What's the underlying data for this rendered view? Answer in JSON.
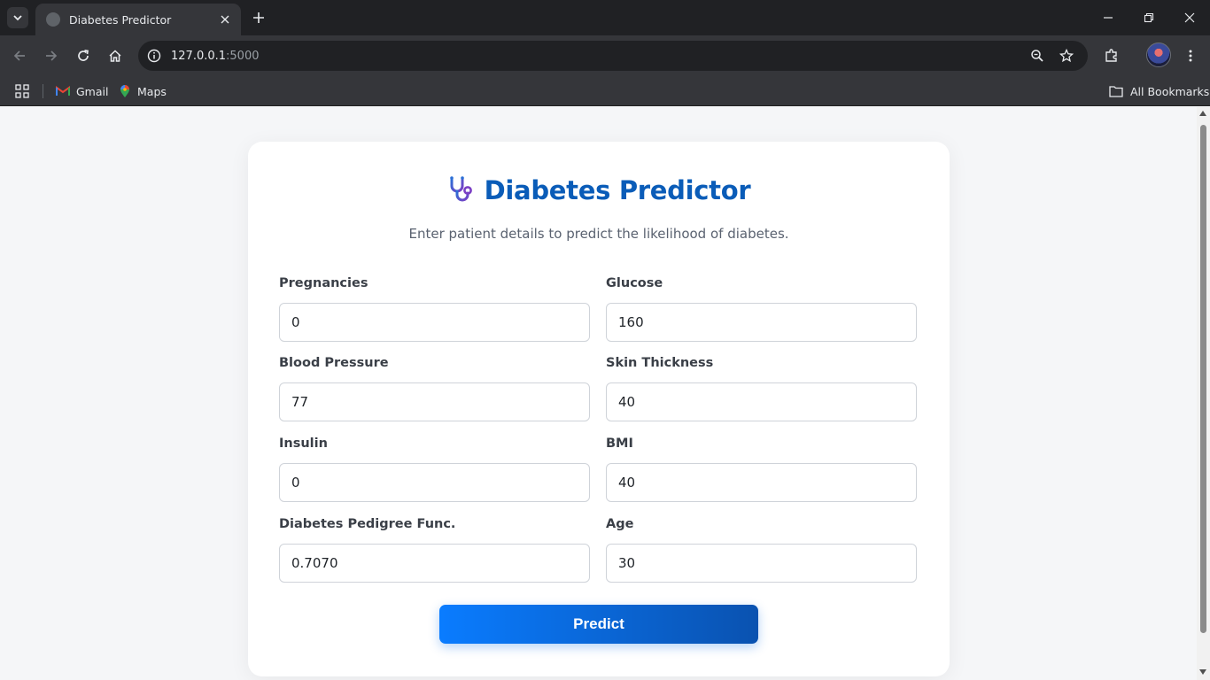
{
  "browser": {
    "tab_title": "Diabetes Predictor",
    "url_host": "127.0.0.1",
    "url_port": ":5000",
    "bookmarks": [
      {
        "label": "Gmail",
        "icon": "gmail-icon"
      },
      {
        "label": "Maps",
        "icon": "maps-icon"
      }
    ],
    "all_bookmarks_label": "All Bookmarks"
  },
  "page": {
    "title": "Diabetes Predictor",
    "title_icon": "stethoscope-icon",
    "subtitle": "Enter patient details to predict the likelihood of diabetes.",
    "fields": [
      {
        "label": "Pregnancies",
        "value": "0"
      },
      {
        "label": "Glucose",
        "value": "160"
      },
      {
        "label": "Blood Pressure",
        "value": "77"
      },
      {
        "label": "Skin Thickness",
        "value": "40"
      },
      {
        "label": "Insulin",
        "value": "0"
      },
      {
        "label": "BMI",
        "value": "40"
      },
      {
        "label": "Diabetes Pedigree Func.",
        "value": "0.7070"
      },
      {
        "label": "Age",
        "value": "30"
      }
    ],
    "submit_label": "Predict"
  },
  "colors": {
    "brand_blue": "#0a5cb8",
    "button_start": "#0a7cff",
    "button_end": "#0a52b0"
  }
}
